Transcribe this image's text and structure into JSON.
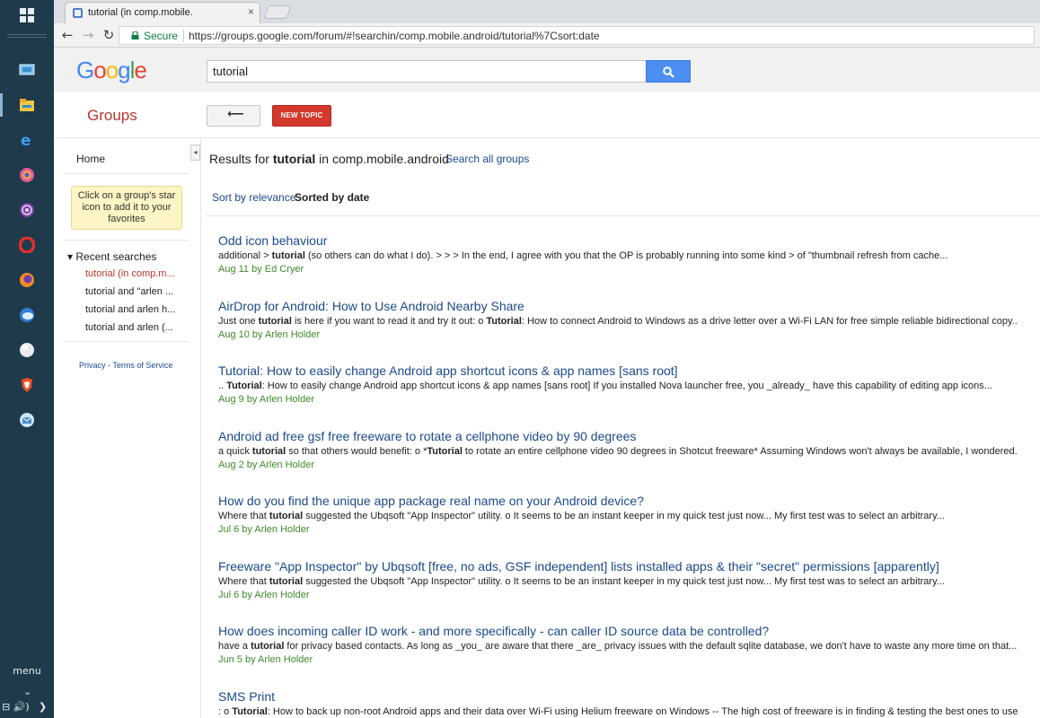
{
  "taskbar": {
    "menu_label": "menu",
    "tray_left": "⊟ 🔊)",
    "tray_right": "❯"
  },
  "browser": {
    "tab_title": "tutorial (in comp.mobile.",
    "tab_close": "×",
    "secure_label": "Secure",
    "url": "https://groups.google.com/forum/#!searchin/comp.mobile.android/tutorial%7Csort:date"
  },
  "google": {
    "logo_letters": [
      {
        "char": "G",
        "color": "#4285f4"
      },
      {
        "char": "o",
        "color": "#ea4335"
      },
      {
        "char": "o",
        "color": "#fbbc05"
      },
      {
        "char": "g",
        "color": "#4285f4"
      },
      {
        "char": "l",
        "color": "#34a853"
      },
      {
        "char": "e",
        "color": "#ea4335"
      }
    ],
    "search_value": "tutorial"
  },
  "groups_bar": {
    "title": "Groups",
    "back_label": "⟵",
    "new_topic_label": "NEW TOPIC"
  },
  "left_pane": {
    "collapse": "◂",
    "home": "Home",
    "star_tip": "Click on a group's star icon to add it to your favorites",
    "recent_header": "▾ Recent searches",
    "recent_searches": [
      {
        "label": "tutorial (in comp.m...",
        "color": "#b7372d"
      },
      {
        "label": "tutorial and \"arlen ...",
        "color": "#222222"
      },
      {
        "label": "tutorial and arlen h...",
        "color": "#222222"
      },
      {
        "label": "tutorial and arlen (...",
        "color": "#222222"
      }
    ],
    "privacy": "Privacy",
    "privacy_sep": " - ",
    "terms": "Terms of Service"
  },
  "results": {
    "heading_prefix": "Results for ",
    "heading_query": "tutorial",
    "heading_suffix": " in comp.mobile.android",
    "search_all": "Search all groups",
    "sort_relevance": "Sort by relevance",
    "sort_date": "Sorted by date",
    "items": [
      {
        "title": "Odd icon behaviour",
        "snippet": [
          {
            "t": "additional > ",
            "b": false
          },
          {
            "t": "tutorial",
            "b": true
          },
          {
            "t": " (so others can do what I do). > > > In the end, I agree with you that the OP is probably running into some kind > of \"thumbnail refresh from cache...",
            "b": false
          }
        ],
        "meta": "Aug 11 by Ed Cryer"
      },
      {
        "title": "AirDrop for Android: How to Use Android Nearby Share",
        "snippet": [
          {
            "t": "Just one ",
            "b": false
          },
          {
            "t": "tutorial",
            "b": true
          },
          {
            "t": " is here if you want to read it and try it out: o ",
            "b": false
          },
          {
            "t": "Tutorial",
            "b": true
          },
          {
            "t": ": How to connect Android to Windows as a drive letter over a Wi-Fi LAN for free simple reliable bidirectional copy...",
            "b": false
          }
        ],
        "meta": "Aug 10 by Arlen Holder"
      },
      {
        "title": "Tutorial: How to easily change Android app shortcut icons & app names [sans root]",
        "snippet": [
          {
            "t": ".. ",
            "b": false
          },
          {
            "t": "Tutorial",
            "b": true
          },
          {
            "t": ": How to easily change Android app shortcut icons & app names [sans root] If you installed Nova launcher free, you _already_ have this capability of editing app icons...",
            "b": false
          }
        ],
        "meta": "Aug 9 by Arlen Holder"
      },
      {
        "title": "Android ad free gsf free freeware to rotate a cellphone video by 90 degrees",
        "snippet": [
          {
            "t": "a quick ",
            "b": false
          },
          {
            "t": "tutorial",
            "b": true
          },
          {
            "t": " so that others would benefit: o *",
            "b": false
          },
          {
            "t": "Tutorial",
            "b": true
          },
          {
            "t": " to rotate an entire cellphone video 90 degrees in Shotcut freeware* Assuming Windows won't always be available, I wondered...",
            "b": false
          }
        ],
        "meta": "Aug 2 by Arlen Holder"
      },
      {
        "title": "How do you find the unique app package real name on your Android device?",
        "snippet": [
          {
            "t": "Where that ",
            "b": false
          },
          {
            "t": "tutorial",
            "b": true
          },
          {
            "t": " suggested the Ubqsoft \"App Inspector\" utility. o It seems to be an instant keeper in my quick test just now... My first test was to select an arbitrary...",
            "b": false
          }
        ],
        "meta": "Jul 6 by Arlen Holder"
      },
      {
        "title": "Freeware \"App Inspector\" by Ubqsoft [free, no ads, GSF independent] lists installed apps & their \"secret\" permissions [apparently]",
        "snippet": [
          {
            "t": "Where that ",
            "b": false
          },
          {
            "t": "tutorial",
            "b": true
          },
          {
            "t": " suggested the Ubqsoft \"App Inspector\" utility. o It seems to be an instant keeper in my quick test just now... My first test was to select an arbitrary...",
            "b": false
          }
        ],
        "meta": "Jul 6 by Arlen Holder"
      },
      {
        "title": "How does incoming caller ID work - and more specifically - can caller ID source data be controlled?",
        "snippet": [
          {
            "t": "have a ",
            "b": false
          },
          {
            "t": "tutorial",
            "b": true
          },
          {
            "t": " for privacy based contacts. As long as _you_ are aware that there _are_ privacy issues with the default sqlite database, we don't have to waste any more time on that...",
            "b": false
          }
        ],
        "meta": "Jun 5 by Arlen Holder"
      },
      {
        "title": "SMS Print",
        "snippet": [
          {
            "t": ": o ",
            "b": false
          },
          {
            "t": "Tutorial",
            "b": true
          },
          {
            "t": ": How to back up non-root Android apps and their data over Wi-Fi using Helium freeware on Windows -- The high cost of freeware is in finding & testing the best ones to use...",
            "b": false
          }
        ],
        "meta": ""
      }
    ]
  }
}
